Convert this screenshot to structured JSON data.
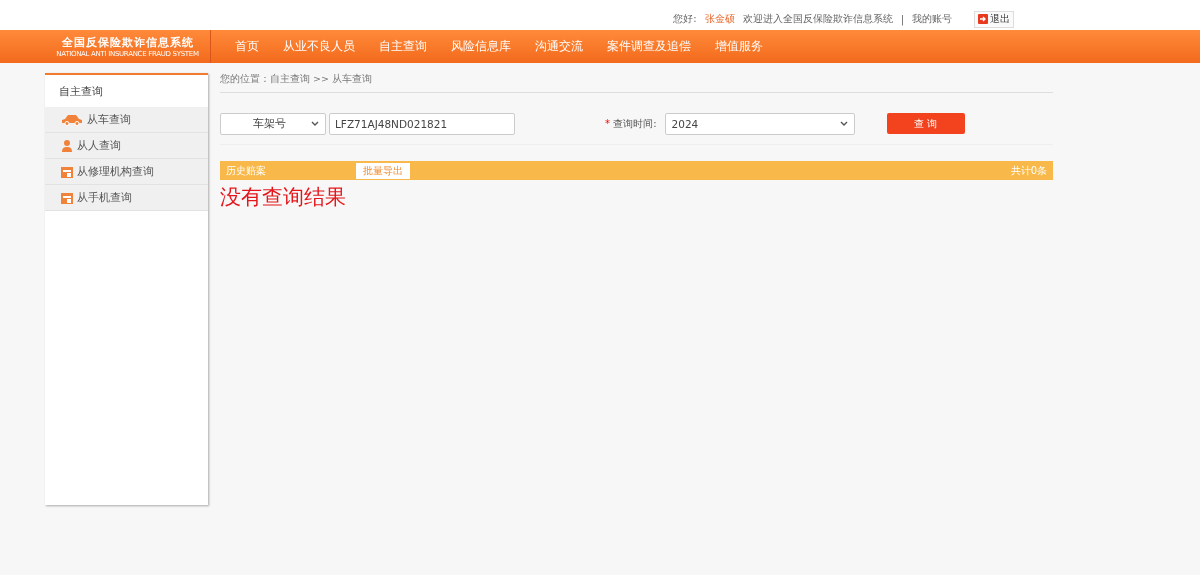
{
  "top_bar": {
    "greeting": "您好:",
    "user": "张金硕",
    "welcome": "欢迎进入全国反保险欺诈信息系统",
    "separator": "|",
    "account_link": "我的账号",
    "logout_button": "退出"
  },
  "logo": {
    "title": "全国反保险欺诈信息系统",
    "subtitle": "NATIONAL ANTI INSURANCE FRAUD SYSTEM"
  },
  "nav": [
    "首页",
    "从业不良人员",
    "自主查询",
    "风险信息库",
    "沟通交流",
    "案件调查及追偿",
    "增值服务"
  ],
  "sidebar": {
    "title": "自主查询",
    "items": [
      {
        "label": "从车查询",
        "kind": "car"
      },
      {
        "label": "从人查询",
        "kind": "person"
      },
      {
        "label": "从修理机构查询",
        "kind": "calendar"
      },
      {
        "label": "从手机查询",
        "kind": "calendar"
      }
    ]
  },
  "breadcrumb": "您的位置：自主查询 >> 从车查询",
  "form": {
    "field_type": "车架号",
    "vin": "LFZ71AJ48ND021821",
    "required_mark": "*",
    "time_label": "查询时间:",
    "year": "2024",
    "submit": "查 询"
  },
  "results": {
    "title": "历史赔案",
    "export": "批量导出",
    "total": "共计0条",
    "empty_message": "没有查询结果"
  }
}
